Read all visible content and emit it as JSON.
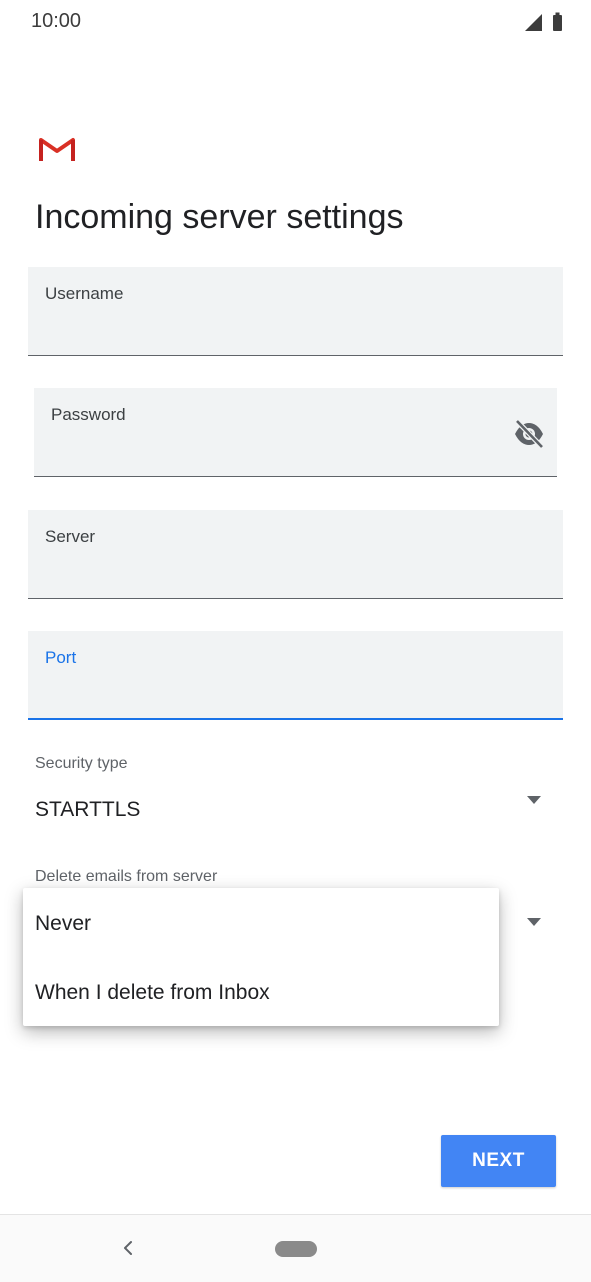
{
  "status_bar": {
    "time": "10:00",
    "icons": [
      "signal-icon",
      "battery-icon"
    ]
  },
  "app": {
    "logo": "gmail-logo-icon",
    "title": "Incoming server settings"
  },
  "fields": {
    "username": {
      "label": "Username",
      "value": ""
    },
    "password": {
      "label": "Password",
      "value": "",
      "toggle_icon": "visibility-off-icon"
    },
    "server": {
      "label": "Server",
      "value": ""
    },
    "port": {
      "label": "Port",
      "value": "",
      "focused": true
    }
  },
  "security_type": {
    "label": "Security type",
    "selected": "STARTTLS"
  },
  "delete_emails": {
    "label": "Delete emails from server",
    "menu_open": true,
    "options": [
      "Never",
      "When I delete from Inbox"
    ]
  },
  "actions": {
    "next_label": "NEXT"
  },
  "nav_bar": {
    "icons": [
      "back-icon",
      "home-pill-icon"
    ]
  },
  "colors": {
    "accent": "#1a73e8",
    "button": "#4285f4",
    "field_bg": "#f1f3f4",
    "gmail_red": "#d93025"
  }
}
